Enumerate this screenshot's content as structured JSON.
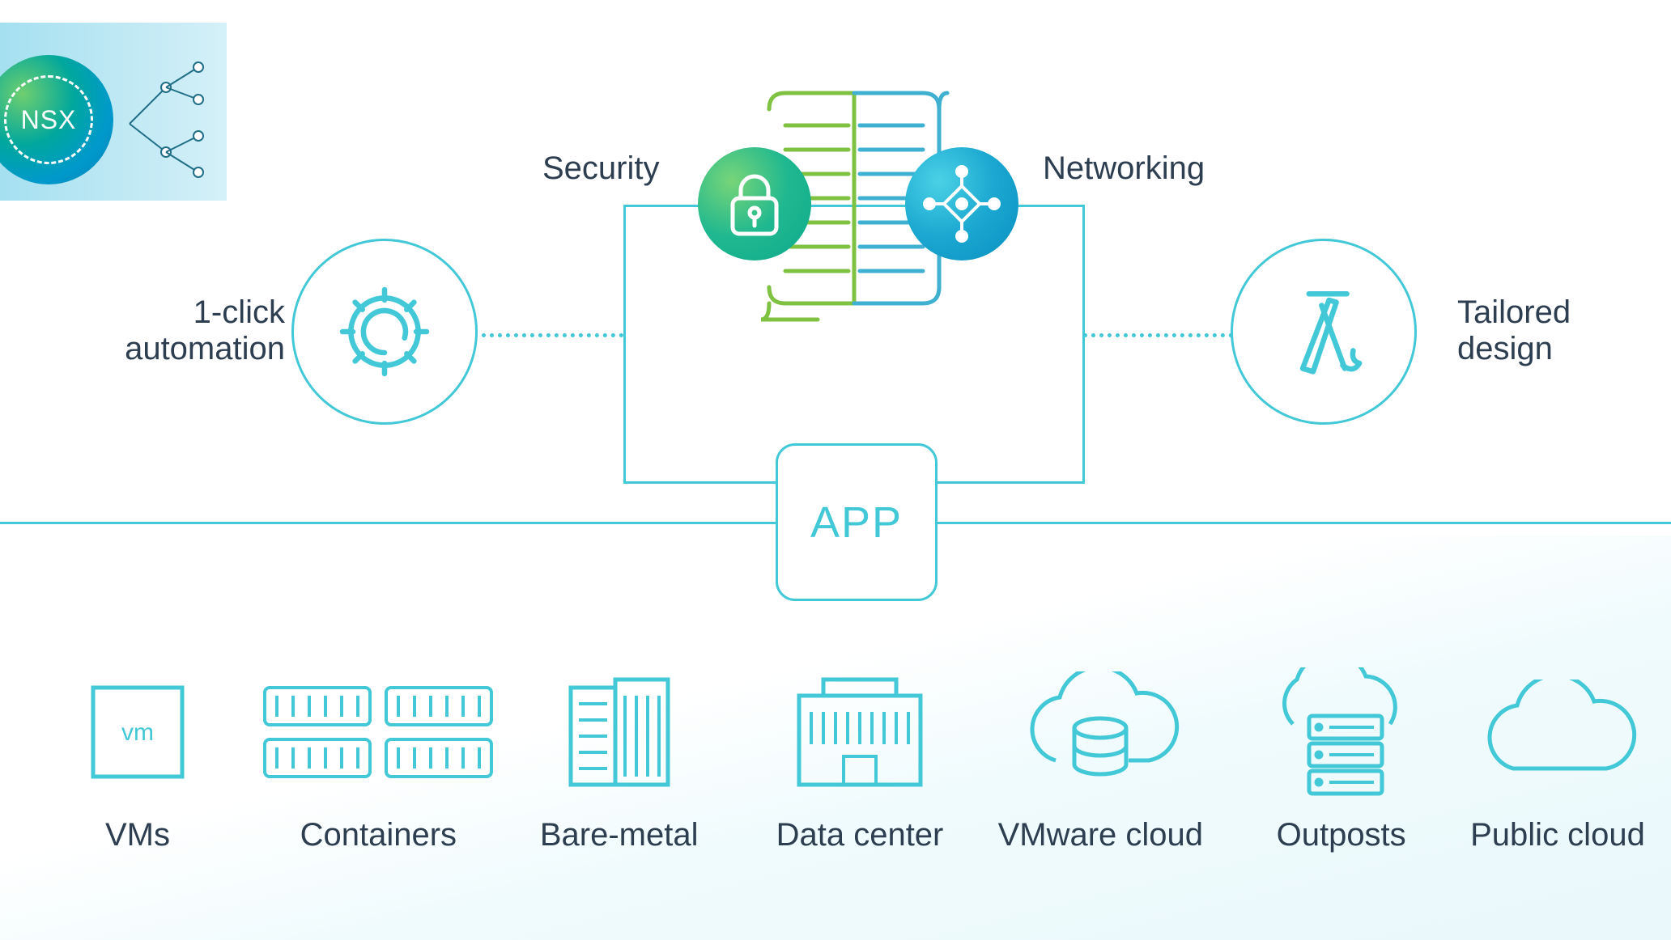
{
  "logo": {
    "text": "NSX"
  },
  "top": {
    "security_label": "Security",
    "networking_label": "Networking",
    "automation_label_line1": "1-click",
    "automation_label_line2": "automation",
    "tailored_label_line1": "Tailored",
    "tailored_label_line2": "design",
    "app_label": "APP"
  },
  "bottom": {
    "items": [
      {
        "label": "VMs",
        "icon": "vm"
      },
      {
        "label": "Containers",
        "icon": "containers"
      },
      {
        "label": "Bare-metal",
        "icon": "building"
      },
      {
        "label": "Data center",
        "icon": "datacenter"
      },
      {
        "label": "VMware cloud",
        "icon": "cloud-db"
      },
      {
        "label": "Outposts",
        "icon": "cloud-stack"
      },
      {
        "label": "Public cloud",
        "icon": "cloud"
      }
    ]
  },
  "colors": {
    "stroke": "#42c8d6",
    "stroke_dark": "#2fa8b5",
    "text": "#2c3e50",
    "green_line": "#7fc241",
    "blue_line": "#3fb0d0"
  }
}
